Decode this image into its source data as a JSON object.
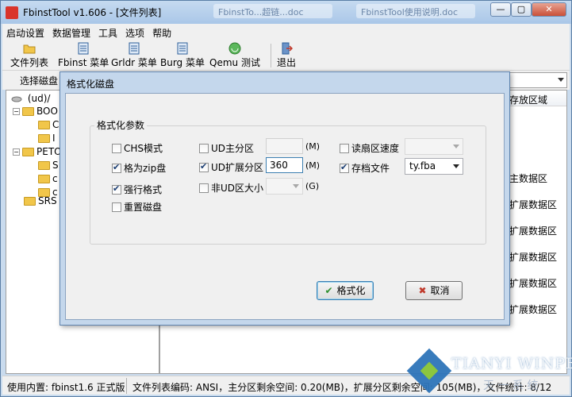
{
  "window": {
    "title": "FbinstTool v1.606 - [文件列表]",
    "bg_tabs": [
      "FbinstTo...超链...doc",
      "FbinstTool使用说明.doc"
    ],
    "minimize": "—",
    "maximize": "▢",
    "close": "✕"
  },
  "menu": [
    "启动设置",
    "数据管理",
    "工具",
    "选项",
    "帮助"
  ],
  "toolbar": {
    "file_list": "文件列表",
    "fbinst_menu": "Fbinst 菜单",
    "grldr_menu": "Grldr 菜单",
    "burg_menu": "Burg 菜单",
    "qemu_test": "Qemu 测试",
    "exit": "退出"
  },
  "disk_select": {
    "label": "选择磁盘"
  },
  "tree": {
    "root": "(ud)/",
    "nodes": [
      "BOO",
      "C",
      "I",
      "PETO",
      "S",
      "c",
      "c",
      "SRS"
    ]
  },
  "right_pane": {
    "column_header": "存放区域",
    "cells": [
      "主数据区",
      "扩展数据区",
      "扩展数据区",
      "扩展数据区",
      "扩展数据区",
      "扩展数据区"
    ]
  },
  "statusbar": {
    "builtin": "使用内置: fbinst1.6 正式版",
    "info": "文件列表编码: ANSI，主分区剩余空间: 0.20(MB)，扩展分区剩余空间: 105(MB)，文件统计: 8/12"
  },
  "watermark": {
    "brand": "TIANYI WINPE",
    "sub": "天 一 系 统"
  },
  "dialog": {
    "title": "格式化磁盘",
    "group_title": "格式化参数",
    "chs_mode": {
      "label": "CHS模式",
      "checked": false
    },
    "zip_disk": {
      "label": "格为zip盘",
      "checked": true
    },
    "force_format": {
      "label": "强行格式",
      "checked": true
    },
    "reset_disk": {
      "label": "重置磁盘",
      "checked": false
    },
    "ud_primary": {
      "label": "UD主分区",
      "checked": false,
      "value": "",
      "unit": "(M)"
    },
    "ud_extended": {
      "label": "UD扩展分区",
      "checked": true,
      "value": "360",
      "unit": "(M)"
    },
    "non_ud_size": {
      "label": "非UD区大小",
      "checked": false,
      "value": "",
      "unit": "(G)"
    },
    "read_speed": {
      "label": "读扇区速度",
      "checked": false,
      "value": ""
    },
    "archive_file": {
      "label": "存档文件",
      "checked": true,
      "value": "ty.fba"
    },
    "format_button": "格式化",
    "cancel_button": "取消"
  }
}
